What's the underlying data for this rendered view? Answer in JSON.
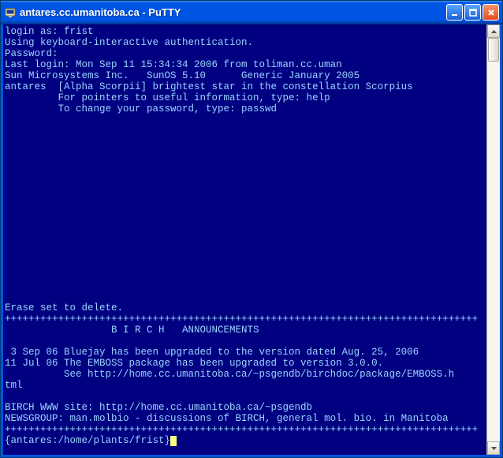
{
  "window": {
    "title": "antares.cc.umanitoba.ca - PuTTY"
  },
  "terminal": {
    "lines": [
      "login as: frist",
      "Using keyboard-interactive authentication.",
      "Password:",
      "Last login: Mon Sep 11 15:34:34 2006 from toliman.cc.uman",
      "Sun Microsystems Inc.   SunOS 5.10      Generic January 2005",
      "antares  [Alpha Scorpii] brightest star in the constellation Scorpius",
      "         For pointers to useful information, type: help",
      "         To change your password, type: passwd",
      "",
      "",
      "",
      "",
      "",
      "",
      "",
      "",
      "",
      "",
      "",
      "",
      "",
      "",
      "",
      "",
      "",
      "Erase set to delete.",
      "++++++++++++++++++++++++++++++++++++++++++++++++++++++++++++++++++++++++++++++++",
      "                  B I R C H   ANNOUNCEMENTS",
      "",
      " 3 Sep 06 Bluejay has been upgraded to the version dated Aug. 25, 2006",
      "11 Jul 06 The EMBOSS package has been upgraded to version 3.0.0.",
      "          See http://home.cc.umanitoba.ca/~psgendb/birchdoc/package/EMBOSS.h",
      "tml",
      "",
      "BIRCH WWW site: http://home.cc.umanitoba.ca/~psgendb",
      "NEWSGROUP: man.molbio - discussions of BIRCH, general mol. bio. in Manitoba",
      "++++++++++++++++++++++++++++++++++++++++++++++++++++++++++++++++++++++++++++++++"
    ],
    "prompt": "{antares:/home/plants/frist}"
  }
}
